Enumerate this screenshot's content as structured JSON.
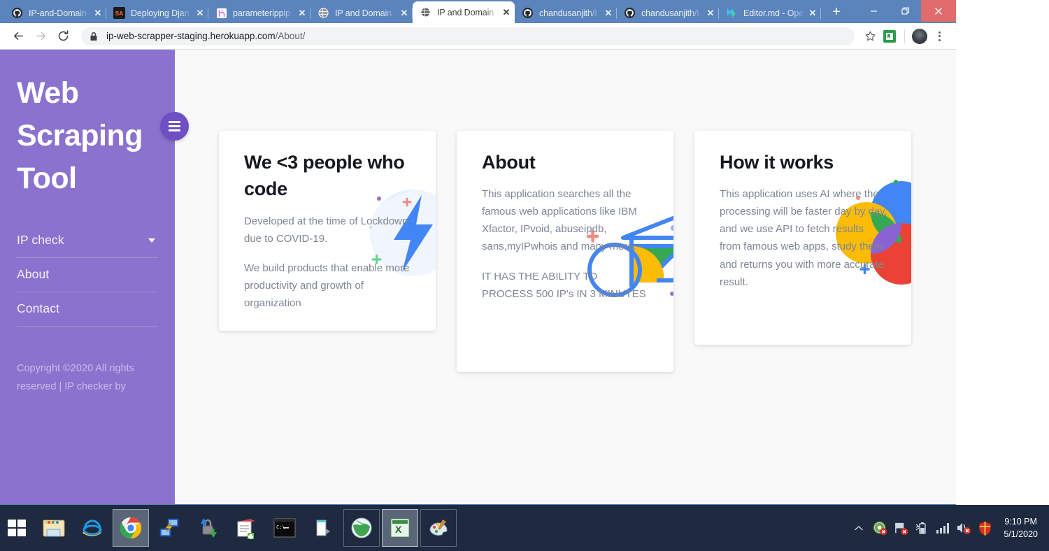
{
  "browser": {
    "tabs": [
      {
        "title": "IP-and-Domain-",
        "favicon": "github-icon",
        "active": false
      },
      {
        "title": "Deploying Djan",
        "favicon": "stackabuse-icon",
        "active": false
      },
      {
        "title": "parameterippip",
        "favicon": "heroku-icon",
        "active": false
      },
      {
        "title": "IP and Domain",
        "favicon": "globe-icon",
        "active": false
      },
      {
        "title": "IP and Domain",
        "favicon": "globe-icon",
        "active": true
      },
      {
        "title": "chandusanjith/I",
        "favicon": "github-icon",
        "active": false
      },
      {
        "title": "chandusanjith/I",
        "favicon": "github-icon",
        "active": false
      },
      {
        "title": "Editor.md - Ope",
        "favicon": "editormd-icon",
        "active": false
      }
    ],
    "new_tab_label": "+",
    "close_label": "✕",
    "window_controls": {
      "minimize": "—",
      "maximize": "❐",
      "close": "✕"
    },
    "toolbar": {
      "back_label": "←",
      "forward_label": "→",
      "reload_label": "⟳",
      "url_domain": "ip-web-scrapper-staging.herokuapp.com",
      "url_path": "/About/",
      "bookmark_label": "☆"
    }
  },
  "sidebar": {
    "brand": "Web Scraping Tool",
    "items": [
      {
        "label": "IP check",
        "has_caret": true
      },
      {
        "label": "About",
        "has_caret": false
      },
      {
        "label": "Contact",
        "has_caret": false
      }
    ],
    "copyright": "Copyright ©2020 All rights reserved | IP checker by",
    "hamburger_name": "hamburger-menu-button"
  },
  "cards": [
    {
      "title": "We <3 people who code",
      "paragraphs": [
        "Developed at the time of Lockdown due to COVID-19.",
        "We build products that enable more productivity and growth of organization"
      ],
      "art": "lightning-bolt-illustration"
    },
    {
      "title": "About",
      "paragraphs": [
        "This application searches all the famous web applications like IBM Xfactor, IPvoid, abuseipdb, sans,myIPwhois and many more.",
        "IT HAS THE ABILITY TO PROCESS 500 IP's IN 3 MINUTES"
      ],
      "art": "bicycle-geometry-illustration"
    },
    {
      "title": "How it works",
      "paragraphs": [
        "This application uses AI where the processing will be faster day by day, and we use API to fetch results from famous web apps, study them and returns you with more accurate result."
      ],
      "art": "overlapping-circles-illustration"
    }
  ],
  "taskbar": {
    "start_label": "start-button",
    "items": [
      {
        "name": "file-explorer",
        "active": false
      },
      {
        "name": "internet-explorer",
        "active": false
      },
      {
        "name": "google-chrome",
        "active": true
      },
      {
        "name": "network-connection",
        "active": false
      },
      {
        "name": "secure-transfer",
        "active": false
      },
      {
        "name": "notepad-plus-plus",
        "active": false
      },
      {
        "name": "command-prompt",
        "active": false
      },
      {
        "name": "text-document",
        "active": false
      },
      {
        "name": "web-browser",
        "active": false
      },
      {
        "name": "excel",
        "active": false
      },
      {
        "name": "paint",
        "active": false
      }
    ],
    "tray": [
      "show-hidden-icons",
      "antivirus-icon",
      "action-center-icon",
      "battery-icon",
      "network-signal-icon",
      "volume-muted-icon",
      "security-shield-icon"
    ],
    "time": "9:10 PM",
    "date": "5/1/2020"
  },
  "colors": {
    "sidebar_purple": "#8b72ce",
    "accent_purple": "#6f4fc4",
    "browser_frame": "#5b84bd",
    "taskbar": "#1e2a40",
    "close_red": "#e06c6c"
  }
}
